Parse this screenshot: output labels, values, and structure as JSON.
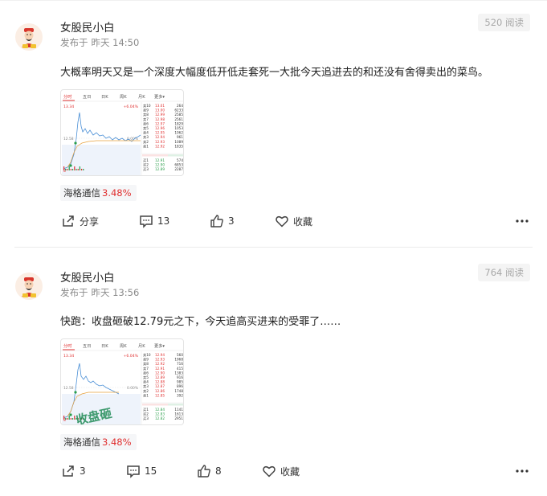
{
  "posts": [
    {
      "username": "女股民小白",
      "time_prefix": "发布于",
      "time": "昨天 14:50",
      "reads": "520 阅读",
      "content": "大概率明天又是一个深度大幅度低开低走套死一大批今天追进去的和还没有舍得卖出的菜鸟。",
      "stock_name": "海格通信",
      "stock_change": "3.48%",
      "actions": {
        "share": "分享",
        "comments": "13",
        "likes": "3",
        "favorite": "收藏"
      },
      "chart": {
        "tabs": [
          "分时",
          "五日",
          "日K",
          "周K",
          "月K",
          "更多▾"
        ],
        "top_price": "13.34",
        "mid_price": "12.58",
        "bottom_price": "8",
        "change_label": "+6.04%",
        "mid_change": "0.00%",
        "sell_rows": [
          [
            "卖10",
            "13.01",
            "264"
          ],
          [
            "卖9",
            "13.00",
            "6233"
          ],
          [
            "卖8",
            "12.99",
            "2585"
          ],
          [
            "卖7",
            "12.98",
            "2561"
          ],
          [
            "卖6",
            "12.97",
            "1829"
          ],
          [
            "卖5",
            "12.96",
            "1053"
          ],
          [
            "卖4",
            "12.95",
            "1062"
          ],
          [
            "卖3",
            "12.94",
            "961"
          ],
          [
            "卖2",
            "12.93",
            "1089"
          ],
          [
            "卖1",
            "12.92",
            "1835"
          ]
        ],
        "buy_rows": [
          [
            "买1",
            "12.91",
            "574"
          ],
          [
            "买2",
            "12.90",
            "6853"
          ],
          [
            "买3",
            "12.89",
            "2287"
          ]
        ]
      }
    },
    {
      "username": "女股民小白",
      "time_prefix": "发布于",
      "time": "昨天 13:56",
      "reads": "764 阅读",
      "content": "快跑：收盘砸破12.79元之下，今天追高买进来的受罪了……",
      "stock_name": "海格通信",
      "stock_change": "3.48%",
      "actions": {
        "share": "3",
        "comments": "15",
        "likes": "8",
        "favorite": "收藏"
      },
      "chart": {
        "tabs": [
          "分时",
          "五日",
          "日K",
          "周K",
          "月K",
          "更多▾"
        ],
        "top_price": "13.34",
        "mid_price": "12.58",
        "bottom_price": "8",
        "change_label": "+6.04%",
        "mid_change": "0.00%",
        "overlay_text": "收盘砸",
        "sell_rows": [
          [
            "卖10",
            "12.94",
            "560"
          ],
          [
            "卖9",
            "12.93",
            "1968"
          ],
          [
            "卖8",
            "12.92",
            "716"
          ],
          [
            "卖7",
            "12.91",
            "415"
          ],
          [
            "卖6",
            "12.90",
            "1383"
          ],
          [
            "卖5",
            "12.89",
            "916"
          ],
          [
            "卖4",
            "12.88",
            "985"
          ],
          [
            "卖3",
            "12.87",
            "896"
          ],
          [
            "卖2",
            "12.86",
            "1748"
          ],
          [
            "卖1",
            "12.85",
            "392"
          ]
        ],
        "buy_rows": [
          [
            "买1",
            "12.84",
            "1141"
          ],
          [
            "买2",
            "12.83",
            "1613"
          ],
          [
            "买3",
            "12.82",
            "2951"
          ]
        ]
      }
    }
  ],
  "colors": {
    "up": "#e03030",
    "down": "#2a9d4a",
    "line": "#4a8fd6",
    "avg": "#e8a13c",
    "muted": "#8a8a8a"
  },
  "icons": [
    "avatar-icon",
    "share-icon",
    "comment-icon",
    "like-icon",
    "favorite-icon",
    "more-icon"
  ]
}
